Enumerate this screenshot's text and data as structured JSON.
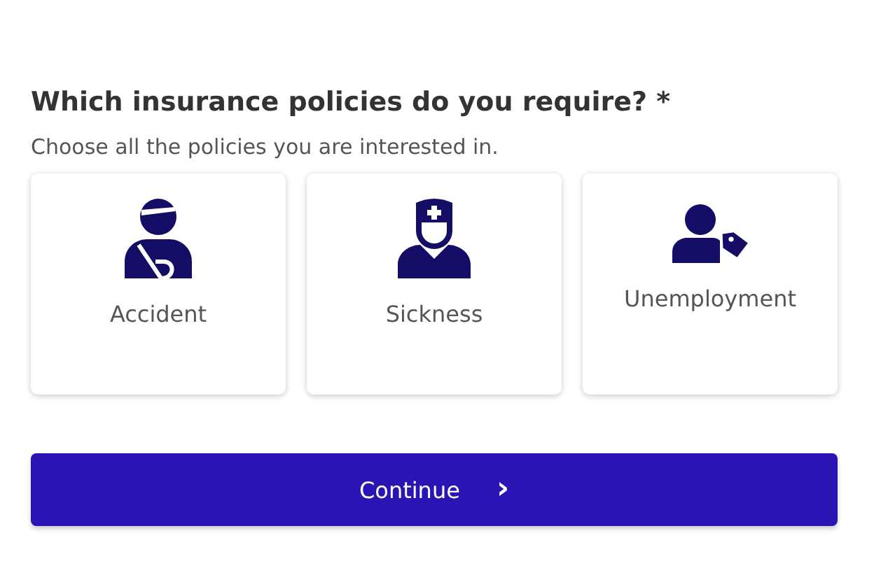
{
  "question": {
    "title": "Which insurance policies do you require? *",
    "hint": "Choose all the policies you are interested in."
  },
  "options": [
    {
      "kind": "accident",
      "label": "Accident"
    },
    {
      "kind": "sickness",
      "label": "Sickness"
    },
    {
      "kind": "unemployment",
      "label": "Unemployment"
    }
  ],
  "button": {
    "label": "Continue",
    "icon": "›"
  }
}
